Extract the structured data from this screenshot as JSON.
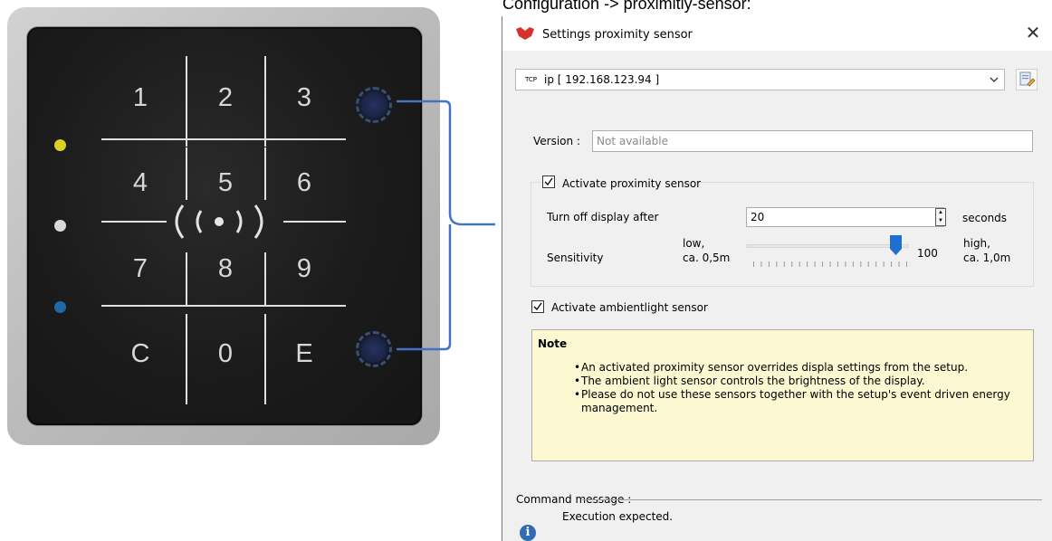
{
  "caption": "Configuration -> proximitiy-sensor:",
  "keypad": {
    "keys": [
      "1",
      "2",
      "3",
      "4",
      "5",
      "6",
      "7",
      "8",
      "9",
      "C",
      "0",
      "E"
    ],
    "proximity_symbol": "( ( • ) )",
    "led_colors": [
      "#d8d12a",
      "#d9d9d9",
      "#1f6aa6"
    ]
  },
  "window": {
    "title": "Settings proximity sensor",
    "close_glyph": "✕",
    "device_select": {
      "tag": "TCP",
      "value": "ip [ 192.168.123.94 ]"
    },
    "version": {
      "label": "Version :",
      "value": "Not available"
    },
    "proximity": {
      "checkbox_label": "Activate proximity sensor",
      "checked": true,
      "turn_off_label": "Turn off display after",
      "turn_off_value": "20",
      "turn_off_unit": "seconds",
      "sensitivity_label": "Sensitivity",
      "low_label_1": "low,",
      "low_label_2": "ca. 0,5m",
      "high_label_1": "high,",
      "high_label_2": "ca. 1,0m",
      "slider_value": "100",
      "slider_fraction": 0.95
    },
    "ambient": {
      "checkbox_label": "Activate ambientlight sensor",
      "checked": true
    },
    "note": {
      "title": "Note",
      "items": [
        "An activated proximity sensor overrides displa settings from the setup.",
        "The ambient light sensor controls the brightness of the display.",
        "Please do not use these sensors together with the setup's event driven energy management."
      ]
    },
    "command_message": {
      "label": "Command message :",
      "text": "Execution expected."
    }
  },
  "colors": {
    "accent_blue": "#4472c4",
    "note_bg": "#fbf8d2",
    "slider_thumb": "#1e6fd0",
    "logo_red": "#d6322c"
  }
}
